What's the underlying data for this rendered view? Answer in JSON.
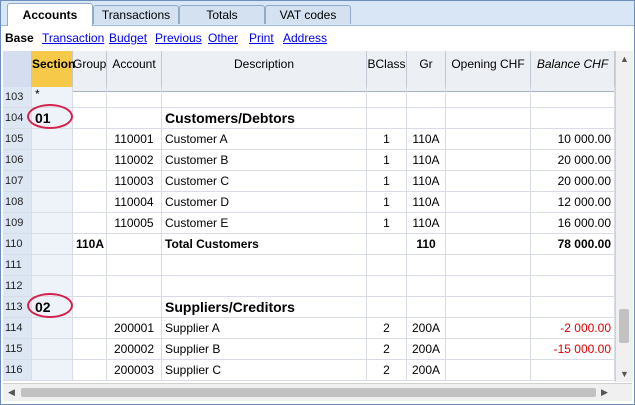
{
  "tabs": [
    {
      "label": "Accounts",
      "active": true
    },
    {
      "label": "Transactions",
      "active": false
    },
    {
      "label": "Totals",
      "active": false
    },
    {
      "label": "VAT codes",
      "active": false
    }
  ],
  "views": [
    {
      "label": "Base",
      "current": true
    },
    {
      "label": "Transaction",
      "current": false
    },
    {
      "label": "Budget",
      "current": false
    },
    {
      "label": "Previous",
      "current": false
    },
    {
      "label": "Other",
      "current": false
    },
    {
      "label": "Print",
      "current": false
    },
    {
      "label": "Address",
      "current": false
    }
  ],
  "columns": {
    "section": "Section",
    "group": "Group",
    "account": "Account",
    "description": "Description",
    "bclass": "BClass",
    "gr": "Gr",
    "opening": "Opening CHF",
    "balance": "Balance CHF"
  },
  "rows": [
    {
      "num": "103",
      "section": "*",
      "group": "",
      "account": "",
      "description": "",
      "bclass": "",
      "gr": "",
      "opening": "",
      "balance": ""
    },
    {
      "num": "104",
      "section": "01",
      "group": "",
      "account": "",
      "description": "Customers/Debtors",
      "bclass": "",
      "gr": "",
      "opening": "",
      "balance": ""
    },
    {
      "num": "105",
      "section": "",
      "group": "",
      "account": "110001",
      "description": "Customer A",
      "bclass": "1",
      "gr": "110A",
      "opening": "",
      "balance": "10 000.00"
    },
    {
      "num": "106",
      "section": "",
      "group": "",
      "account": "110002",
      "description": "Customer B",
      "bclass": "1",
      "gr": "110A",
      "opening": "",
      "balance": "20 000.00"
    },
    {
      "num": "107",
      "section": "",
      "group": "",
      "account": "110003",
      "description": "Customer C",
      "bclass": "1",
      "gr": "110A",
      "opening": "",
      "balance": "20 000.00"
    },
    {
      "num": "108",
      "section": "",
      "group": "",
      "account": "110004",
      "description": "Customer D",
      "bclass": "1",
      "gr": "110A",
      "opening": "",
      "balance": "12 000.00"
    },
    {
      "num": "109",
      "section": "",
      "group": "",
      "account": "110005",
      "description": "Customer E",
      "bclass": "1",
      "gr": "110A",
      "opening": "",
      "balance": "16 000.00"
    },
    {
      "num": "110",
      "section": "",
      "group": "110A",
      "account": "",
      "description": "Total Customers",
      "bclass": "",
      "gr": "110",
      "opening": "",
      "balance": "78 000.00"
    },
    {
      "num": "111",
      "section": "",
      "group": "",
      "account": "",
      "description": "",
      "bclass": "",
      "gr": "",
      "opening": "",
      "balance": ""
    },
    {
      "num": "112",
      "section": "",
      "group": "",
      "account": "",
      "description": "",
      "bclass": "",
      "gr": "",
      "opening": "",
      "balance": ""
    },
    {
      "num": "113",
      "section": "02",
      "group": "",
      "account": "",
      "description": "Suppliers/Creditors",
      "bclass": "",
      "gr": "",
      "opening": "",
      "balance": ""
    },
    {
      "num": "114",
      "section": "",
      "group": "",
      "account": "200001",
      "description": "Supplier A",
      "bclass": "2",
      "gr": "200A",
      "opening": "",
      "balance": "-2 000.00"
    },
    {
      "num": "115",
      "section": "",
      "group": "",
      "account": "200002",
      "description": "Supplier B",
      "bclass": "2",
      "gr": "200A",
      "opening": "",
      "balance": "-15 000.00"
    },
    {
      "num": "116",
      "section": "",
      "group": "",
      "account": "200003",
      "description": "Supplier C",
      "bclass": "2",
      "gr": "200A",
      "opening": "",
      "balance": ""
    }
  ],
  "colors": {
    "negative": "#e00000",
    "highlight_circle": "#d6214a",
    "link": "#0000ee"
  }
}
